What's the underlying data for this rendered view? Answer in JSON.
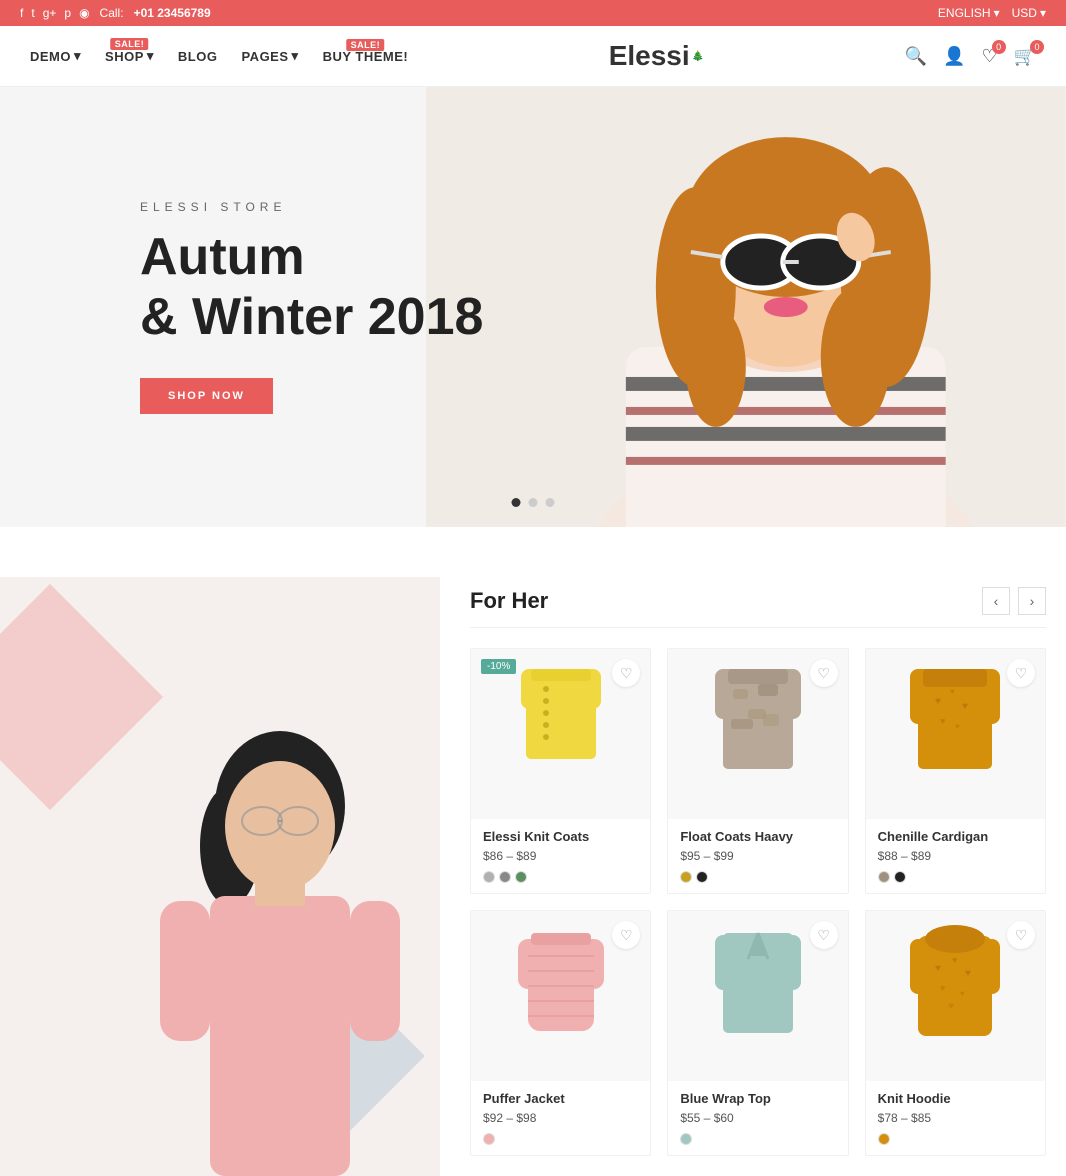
{
  "topbar": {
    "call_label": "Call:",
    "phone": "+01 23456789",
    "lang": "ENGLISH",
    "currency": "USD",
    "social": [
      "f",
      "t",
      "g+",
      "p",
      "ig"
    ]
  },
  "nav": {
    "items": [
      {
        "label": "DEMO",
        "has_dropdown": true,
        "sale": false
      },
      {
        "label": "SHOP",
        "has_dropdown": true,
        "sale": true,
        "sale_text": "SALE!"
      },
      {
        "label": "BLOG",
        "has_dropdown": false,
        "sale": false
      },
      {
        "label": "PAGES",
        "has_dropdown": true,
        "sale": false
      },
      {
        "label": "BUY THEME!",
        "has_dropdown": false,
        "sale": true,
        "sale_text": "SALE!"
      }
    ],
    "logo": "Elessi",
    "wishlist_count": 0,
    "cart_count": 0
  },
  "hero": {
    "subtitle": "ELESSI STORE",
    "title_line1": "Autum",
    "title_line2": "& Winter 2018",
    "cta": "SHOP NOW",
    "dots": [
      true,
      false,
      false
    ]
  },
  "for_her": {
    "section_title": "For Her",
    "products": [
      {
        "name": "Elessi Knit Coats",
        "price": "$86 – $89",
        "discount": "-10%",
        "colors": [
          "#b0b0b0",
          "#888888",
          "#5a9060"
        ],
        "style": "yellow-knit"
      },
      {
        "name": "Float Coats Haavy",
        "price": "$95 – $99",
        "discount": "",
        "colors": [
          "#c8a020",
          "#222222"
        ],
        "style": "camo"
      },
      {
        "name": "Chenille Cardigan",
        "price": "$88 – $89",
        "discount": "",
        "colors": [
          "#a09080",
          "#222222"
        ],
        "style": "orange-knit"
      },
      {
        "name": "Puffer Jacket",
        "price": "$92 – $98",
        "discount": "",
        "colors": [
          "#f0b0b0"
        ],
        "style": "pink-puffer"
      },
      {
        "name": "Blue Wrap Top",
        "price": "$55 – $60",
        "discount": "",
        "colors": [
          "#a0c8c0"
        ],
        "style": "blue-top"
      },
      {
        "name": "Knit Hoodie",
        "price": "$78 – $85",
        "discount": "",
        "colors": [
          "#d4900a"
        ],
        "style": "yellow-hoodie"
      }
    ]
  },
  "icons": {
    "search": "🔍",
    "user": "👤",
    "heart": "♡",
    "cart": "🛒",
    "chevron_down": "▾",
    "chevron_left": "‹",
    "chevron_right": "›",
    "facebook": "f",
    "twitter": "t",
    "gplus": "g",
    "pinterest": "p",
    "instagram": "◉"
  }
}
